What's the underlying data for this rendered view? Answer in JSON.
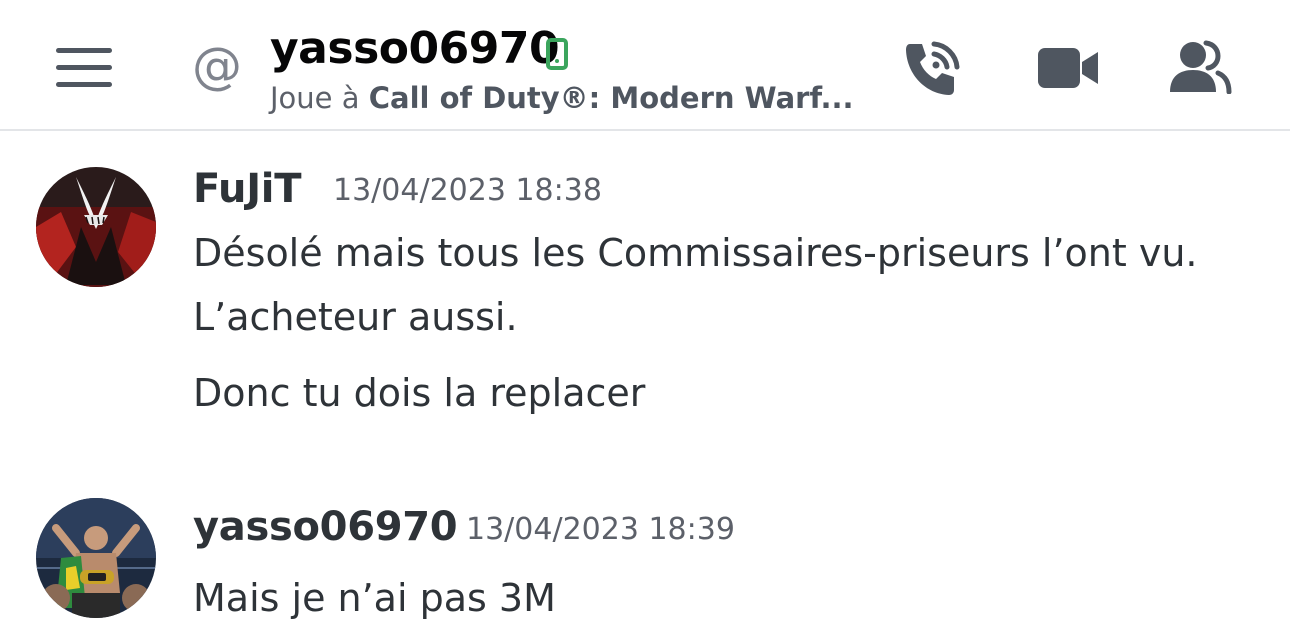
{
  "header": {
    "title": "yasso06970",
    "subtitle_prefix": "Joue à ",
    "subtitle_game": "Call of Duty®: Modern Warf...",
    "status": "mobile-online",
    "accent": "#3ba55d"
  },
  "icons": {
    "menu": "hamburger-menu-icon",
    "channel": "at-icon",
    "call": "phone-call-icon",
    "video": "video-camera-icon",
    "members": "people-icon"
  },
  "messages": [
    {
      "author": "FuJiT",
      "timestamp": "13/04/2023 18:38",
      "lines": [
        "Désolé mais tous les Commissaires-priseurs l’ont vu.",
        "L’acheteur aussi.",
        "Donc tu dois la replacer"
      ]
    },
    {
      "author": "yasso06970",
      "timestamp": "13/04/2023 18:39",
      "lines": [
        "Mais je n’ai pas 3M"
      ]
    }
  ]
}
